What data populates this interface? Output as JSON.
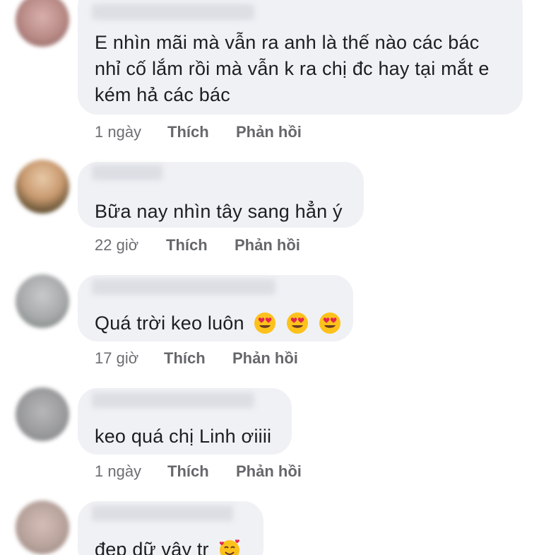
{
  "comments": [
    {
      "text_lines": [
        "E nhìn mãi mà vẫn ra anh  là thế nào các bác",
        "nhỉ cố lắm rồi mà vẫn k ra chị đc hay tại mắt e",
        "kém hả các bác"
      ],
      "time": "1 ngày",
      "like_label": "Thích",
      "reply_label": "Phản hồi"
    },
    {
      "text": "Bữa nay nhìn tây sang hẳn ý",
      "time": "22 giờ",
      "like_label": "Thích",
      "reply_label": "Phản hồi"
    },
    {
      "text": "Quá trời keo luôn",
      "emojis": [
        "heart-eyes-emoji",
        "heart-eyes-emoji",
        "heart-eyes-emoji"
      ],
      "time": "17 giờ",
      "like_label": "Thích",
      "reply_label": "Phản hồi"
    },
    {
      "text": "keo quá chị Linh ơiiii",
      "time": "1 ngày",
      "like_label": "Thích",
      "reply_label": "Phản hồi"
    },
    {
      "text": "đẹp dữ vậy tr",
      "emojis": [
        "smiling-face-with-hearts-emoji"
      ]
    }
  ],
  "colors": {
    "bubble": "#f0f1f5",
    "text": "#1c1e21",
    "meta": "#65676b"
  }
}
